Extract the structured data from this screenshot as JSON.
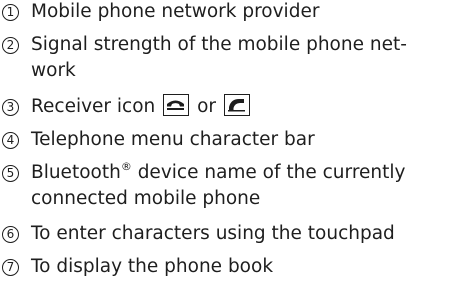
{
  "items": [
    {
      "num": "1",
      "lines": [
        "Mobile phone network provider"
      ]
    },
    {
      "num": "2",
      "lines": [
        "Signal strength of the mobile phone net-",
        "work"
      ]
    },
    {
      "num": "3",
      "before": "Receiver icon",
      "between": "or",
      "icons": [
        "receiver-down-icon",
        "receiver-up-icon"
      ]
    },
    {
      "num": "4",
      "lines": [
        "Telephone menu character bar"
      ]
    },
    {
      "num": "5",
      "line1_text": "Bluetooth",
      "line1_sup": "®",
      "line1_rest": " device name of the currently",
      "line2": "connected mobile phone"
    },
    {
      "num": "6",
      "lines": [
        "To enter characters using the touchpad"
      ]
    },
    {
      "num": "7",
      "lines": [
        "To display the phone book"
      ]
    }
  ]
}
